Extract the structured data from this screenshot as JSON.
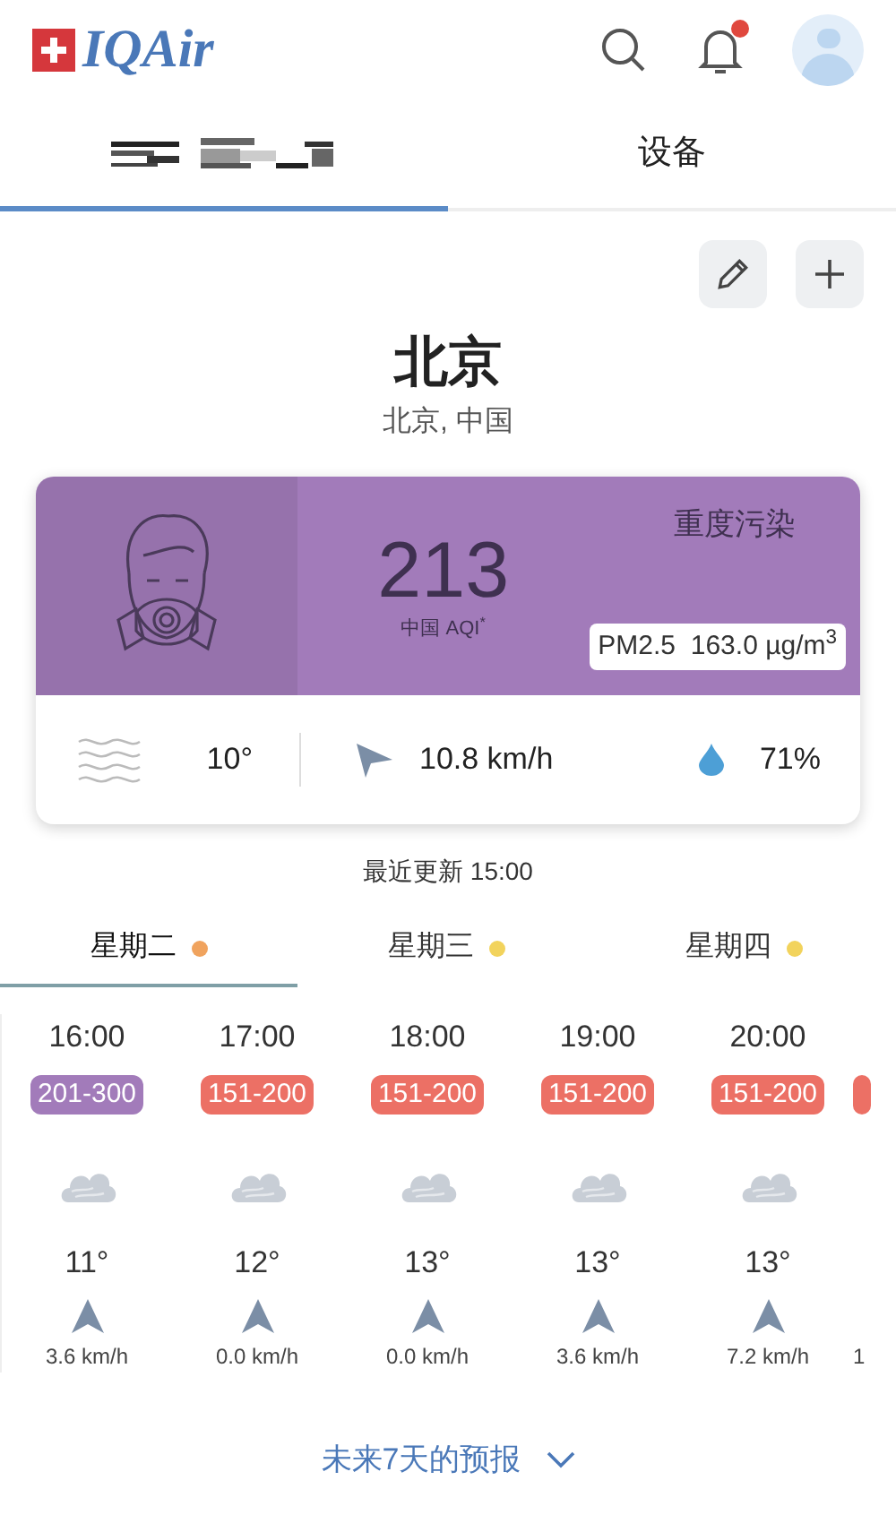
{
  "header": {
    "logo": "IQAir",
    "notification_dot": true
  },
  "tabs": [
    {
      "kind": "redacted",
      "selected": true
    },
    {
      "kind": "text",
      "label": "设备",
      "selected": false
    }
  ],
  "city": {
    "name": "北京",
    "subtitle": "北京, 中国"
  },
  "aqi_card": {
    "color": "#a27bba",
    "value": "213",
    "scale": "中国 AQI",
    "scale_mark": "*",
    "status": "重度污染",
    "pollutant": "PM2.5",
    "concentration": "163.0 µg/m$^{3}$",
    "temperature": "10°",
    "wind": "10.8 km/h",
    "humidity": "71%"
  },
  "updated": "最近更新 15:00",
  "days": [
    {
      "label": "星期二",
      "color": "#f0a35e",
      "selected": true
    },
    {
      "label": "星期三",
      "color": "#f2d35c",
      "selected": false
    },
    {
      "label": "星期四",
      "color": "#f2d35c",
      "selected": false
    }
  ],
  "hours": [
    {
      "time": "16:00",
      "range": "201-300",
      "color": "#a27bba",
      "temp": "11°",
      "wind": "3.6 km/h"
    },
    {
      "time": "17:00",
      "range": "151-200",
      "color": "#ec7065",
      "temp": "12°",
      "wind": "0.0 km/h"
    },
    {
      "time": "18:00",
      "range": "151-200",
      "color": "#ec7065",
      "temp": "13°",
      "wind": "0.0 km/h"
    },
    {
      "time": "19:00",
      "range": "151-200",
      "color": "#ec7065",
      "temp": "13°",
      "wind": "3.6 km/h"
    },
    {
      "time": "20:00",
      "range": "151-200",
      "color": "#ec7065",
      "temp": "13°",
      "wind": "7.2 km/h"
    },
    {
      "color": "#ec7065",
      "wind": "1"
    }
  ],
  "forecast_link": "未来7天的预报"
}
